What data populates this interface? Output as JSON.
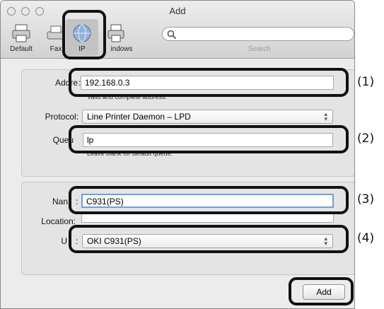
{
  "window": {
    "title": "Add"
  },
  "toolbar": {
    "items": [
      {
        "label": "Default",
        "icon": "printer-default-icon"
      },
      {
        "label": "Fax",
        "icon": "fax-icon"
      },
      {
        "label": "IP",
        "icon": "ip-globe-icon"
      },
      {
        "label": "Windows",
        "display_label": "indows",
        "icon": "windows-printer-icon"
      }
    ]
  },
  "search": {
    "placeholder": "",
    "caption": "Search"
  },
  "form": {
    "address": {
      "label": "Addre",
      "separator": ":",
      "value": "192.168.0.3",
      "hint": "Valid and complete address."
    },
    "protocol": {
      "label": "Protocol:",
      "value": "Line Printer Daemon – LPD"
    },
    "queue": {
      "label": "Queu",
      "value": "lp",
      "hint": "Leave blank for default queue."
    },
    "name": {
      "label": "Nan",
      "separator": ":",
      "value": "C931(PS)"
    },
    "location": {
      "label": "Location:",
      "value": ""
    },
    "use": {
      "label": "U",
      "separator": ":",
      "value": "OKI C931(PS)"
    }
  },
  "buttons": {
    "add": "Add"
  },
  "callouts": [
    "(1)",
    "(2)",
    "(3)",
    "(4)"
  ],
  "colors": {
    "focus_ring": "#6f9fd8",
    "callout_border": "#111111"
  }
}
